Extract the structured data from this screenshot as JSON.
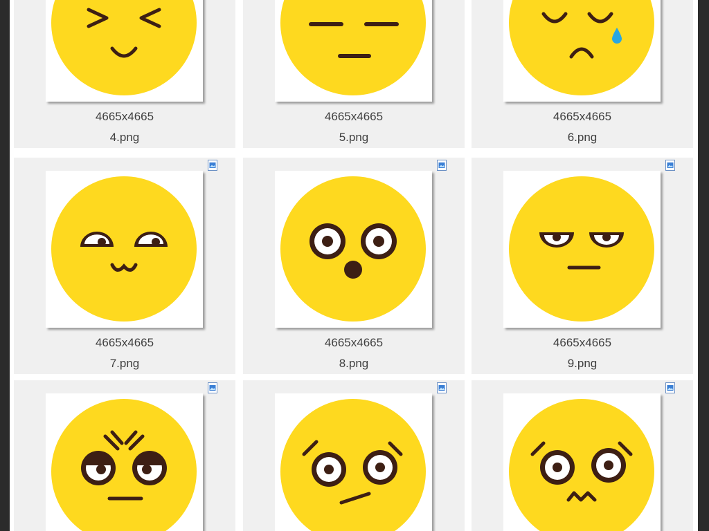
{
  "window": {
    "frame_color": "#2b2b2b",
    "pane_color": "#ffffff",
    "tile_color": "#f0f0f0"
  },
  "file_icon": "image-file-icon",
  "emoji_colors": {
    "face": "#fed91f",
    "ink": "#3d1f14",
    "tear": "#2aa6e0"
  },
  "files": [
    {
      "dimensions": "4665x4665",
      "name": "4.png",
      "face": "squint-smile"
    },
    {
      "dimensions": "4665x4665",
      "name": "5.png",
      "face": "unamused"
    },
    {
      "dimensions": "4665x4665",
      "name": "6.png",
      "face": "sad-tear"
    },
    {
      "dimensions": "4665x4665",
      "name": "7.png",
      "face": "cat-smile"
    },
    {
      "dimensions": "4665x4665",
      "name": "8.png",
      "face": "surprised"
    },
    {
      "dimensions": "4665x4665",
      "name": "9.png",
      "face": "bored"
    },
    {
      "dimensions": "",
      "name": "",
      "face": "angry-sleepy"
    },
    {
      "dimensions": "",
      "name": "",
      "face": "confused"
    },
    {
      "dimensions": "",
      "name": "",
      "face": "worried"
    }
  ]
}
